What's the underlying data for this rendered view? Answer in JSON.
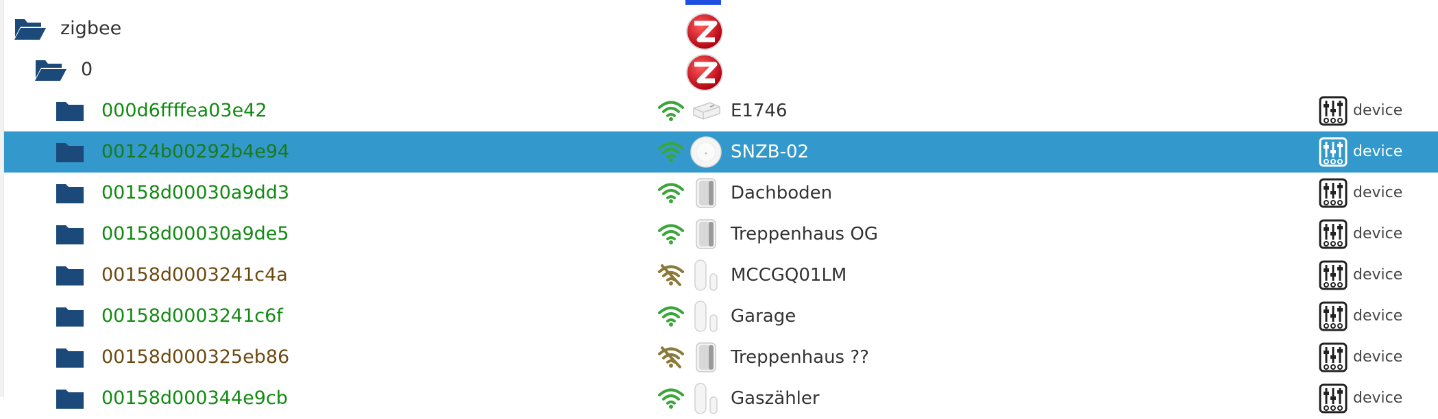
{
  "tree": {
    "root": {
      "label": "zigbee"
    },
    "instance": {
      "label": "0"
    },
    "devices": [
      {
        "id": "000d6ffffea03e42",
        "id_color": "green",
        "name": "E1746",
        "signal": "ok",
        "image": "plug",
        "type": "device",
        "selected": false
      },
      {
        "id": "00124b00292b4e94",
        "id_color": "green",
        "name": "SNZB-02",
        "signal": "ok",
        "image": "round-sensor",
        "type": "device",
        "selected": true
      },
      {
        "id": "00158d00030a9dd3",
        "id_color": "green",
        "name": "Dachboden",
        "signal": "ok",
        "image": "motion-sensor",
        "type": "device",
        "selected": false
      },
      {
        "id": "00158d00030a9de5",
        "id_color": "green",
        "name": "Treppenhaus OG",
        "signal": "ok",
        "image": "motion-sensor",
        "type": "device",
        "selected": false
      },
      {
        "id": "00158d0003241c4a",
        "id_color": "brown",
        "name": "MCCGQ01LM",
        "signal": "off",
        "image": "door-sensor",
        "type": "device",
        "selected": false
      },
      {
        "id": "00158d0003241c6f",
        "id_color": "green",
        "name": "Garage",
        "signal": "ok",
        "image": "door-sensor",
        "type": "device",
        "selected": false
      },
      {
        "id": "00158d000325eb86",
        "id_color": "brown",
        "name": "Treppenhaus ??",
        "signal": "off",
        "image": "motion-sensor",
        "type": "device",
        "selected": false
      },
      {
        "id": "00158d000344e9cb",
        "id_color": "green",
        "name": "Gaszähler",
        "signal": "ok",
        "image": "door-sensor",
        "type": "device",
        "selected": false
      }
    ]
  },
  "colors": {
    "selection": "#3399cc",
    "folder": "#1b4a7a",
    "id_green": "#128a12",
    "id_brown": "#6b4a12",
    "wifi_ok": "#3aa63a",
    "wifi_off": "#8a7a3a"
  },
  "icons": {
    "folder_open": "folder-open-icon",
    "folder": "folder-icon",
    "zigbee_logo": "zigbee-logo-icon",
    "wifi": "wifi-icon",
    "wifi_off": "wifi-off-icon",
    "device_type": "sliders-icon"
  }
}
